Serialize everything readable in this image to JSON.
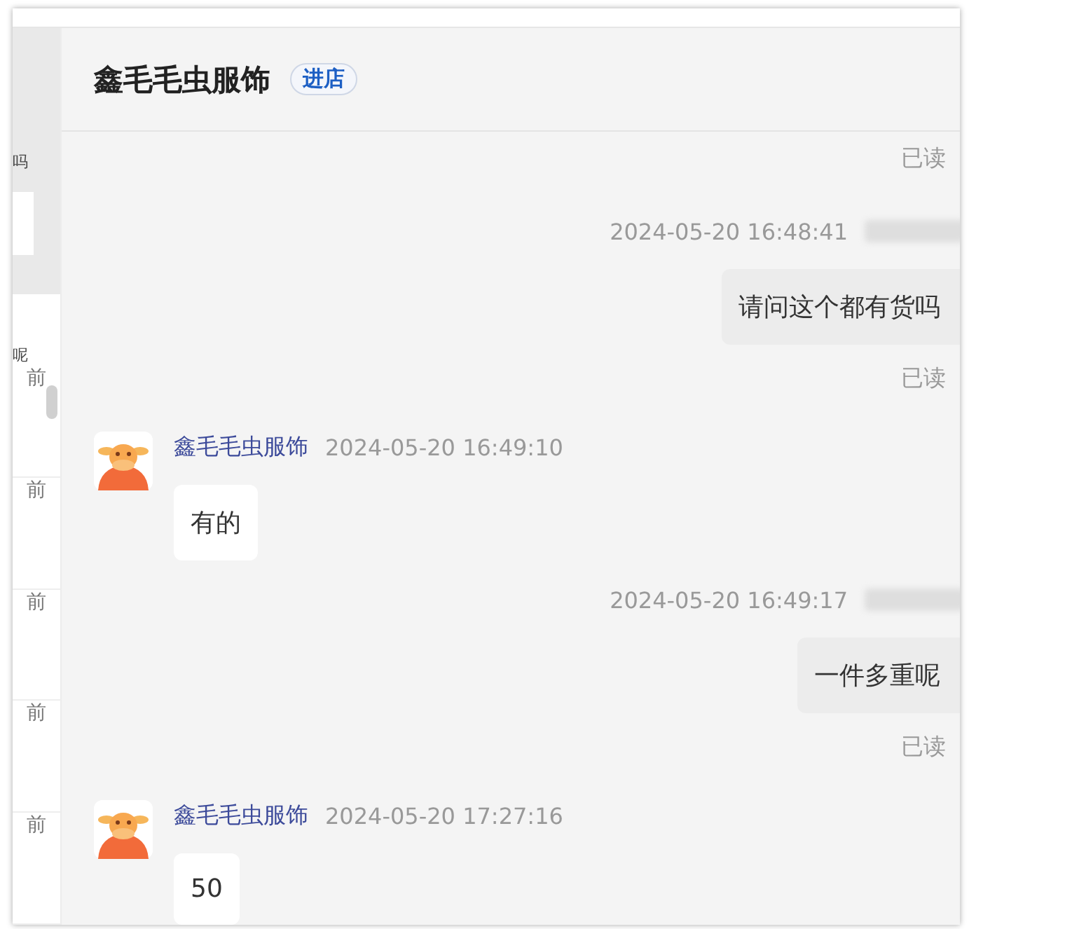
{
  "sidebar": {
    "fragments": [
      {
        "text": "吗"
      },
      {
        "text": "呢"
      }
    ],
    "items": [
      {
        "time": "前"
      },
      {
        "time": "前"
      },
      {
        "time": "前"
      },
      {
        "time": "前"
      },
      {
        "time": "前"
      }
    ]
  },
  "header": {
    "title": "鑫毛毛虫服饰",
    "badge": "进店"
  },
  "messages": [
    {
      "kind": "status",
      "receipt": "已读"
    },
    {
      "kind": "outgoing",
      "time": "2024-05-20 16:48:41",
      "text": "请问这个都有货吗",
      "receipt": "已读"
    },
    {
      "kind": "incoming",
      "sender": "鑫毛毛虫服饰",
      "time": "2024-05-20 16:49:10",
      "text": "有的"
    },
    {
      "kind": "outgoing",
      "time": "2024-05-20 16:49:17",
      "text": "一件多重呢",
      "receipt": "已读"
    },
    {
      "kind": "incoming",
      "sender": "鑫毛毛虫服饰",
      "time": "2024-05-20 17:27:16",
      "text": "50"
    }
  ]
}
